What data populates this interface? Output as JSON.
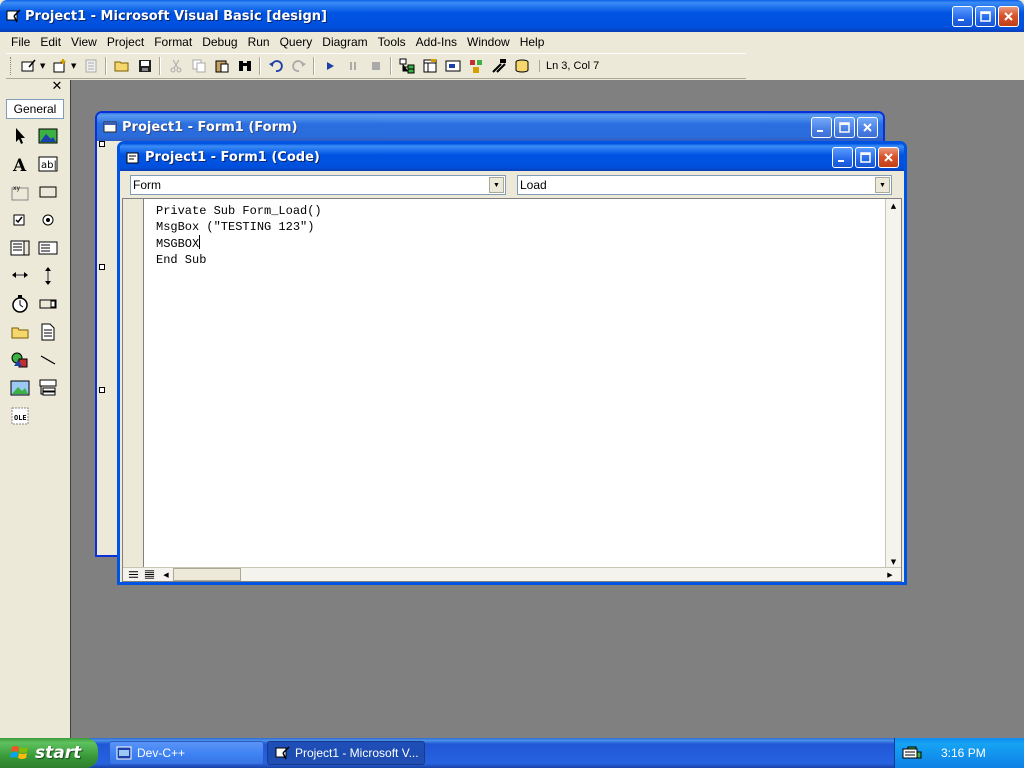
{
  "main_window": {
    "title": "Project1 - Microsoft Visual Basic [design]"
  },
  "menus": [
    "File",
    "Edit",
    "View",
    "Project",
    "Format",
    "Debug",
    "Run",
    "Query",
    "Diagram",
    "Tools",
    "Add-Ins",
    "Window",
    "Help"
  ],
  "toolbar": {
    "position_text": "Ln 3, Col 7"
  },
  "toolbox": {
    "tab_label": "General",
    "close_label": "✕"
  },
  "form_window": {
    "title": "Project1 - Form1 (Form)"
  },
  "code_window": {
    "title": "Project1 - Form1 (Code)",
    "object_combo": "Form",
    "procedure_combo": "Load",
    "lines": [
      "Private Sub Form_Load()",
      "MsgBox (\"TESTING 123\")",
      "MSGBOX",
      "End Sub"
    ]
  },
  "taskbar": {
    "start_label": "start",
    "tasks": [
      {
        "label": "Dev-C++",
        "active": false
      },
      {
        "label": "Project1 - Microsoft V...",
        "active": true
      }
    ],
    "clock": "3:16 PM"
  },
  "colors": {
    "title_blue": "#0054e3",
    "mdi_gray": "#808080",
    "start_green": "#3c9a3c",
    "close_red": "#d8532b",
    "chrome": "#ece9d8"
  }
}
